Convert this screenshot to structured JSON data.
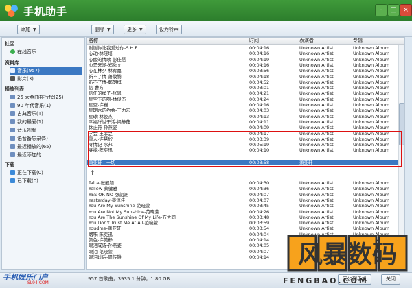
{
  "app": {
    "title": "手机助手"
  },
  "toolbar": {
    "add": "添加",
    "delete": "删除",
    "more": "更多",
    "ringtone": "设为铃声"
  },
  "sidebar": {
    "community": "社区",
    "online_music": "在线音乐",
    "library": "资料库",
    "music": "音乐(957)",
    "video": "影片(3)",
    "playlists_title": "播放列表",
    "playlists": [
      "25 大金曲排行榜(25)",
      "90 年代音乐(1)",
      "古典音乐(1)",
      "我的最爱(1)",
      "音乐视频",
      "语音备忘录(5)",
      "最近播放的(65)",
      "最近添加的"
    ],
    "downloads_title": "下载",
    "downloading": "正在下载(0)",
    "downloaded": "已下载(0)"
  },
  "columns": {
    "name": "名称",
    "time": "时间",
    "artist": "表演者",
    "album": "专辑"
  },
  "rows_top": [
    {
      "name": "谢谢你让我爱过你-S.H.E.",
      "time": "00:04:16",
      "artist": "Unknown Artist",
      "album": "Unknown Album"
    },
    {
      "name": "心动-林晓培",
      "time": "00:04:16",
      "artist": "Unknown Artist",
      "album": "Unknown Album"
    },
    {
      "name": "心酸的情歌-彭佳慧",
      "time": "00:04:19",
      "artist": "Unknown Artist",
      "album": "Unknown Album"
    },
    {
      "name": "心是来潮-郑秀文",
      "time": "00:04:16",
      "artist": "Unknown Artist",
      "album": "Unknown Album"
    },
    {
      "name": "心在林夕-林宥嘉",
      "time": "00:03:56",
      "artist": "Unknown Artist",
      "album": "Unknown Album"
    },
    {
      "name": "新不了情-萧敬腾",
      "time": "00:04:18",
      "artist": "Unknown Artist",
      "album": "Unknown Album"
    },
    {
      "name": "新不了情-鄭朗棋",
      "time": "00:04:52",
      "artist": "Unknown Artist",
      "album": "Unknown Album"
    },
    {
      "name": "信-曹方",
      "time": "00:03:01",
      "artist": "Unknown Artist",
      "album": "Unknown Album"
    },
    {
      "name": "信任的样子-张恩",
      "time": "00:04:21",
      "artist": "Unknown Artist",
      "album": "Unknown Album"
    },
    {
      "name": "星空下的吻-林俊杰",
      "time": "00:04:24",
      "artist": "Unknown Artist",
      "album": "Unknown Album"
    },
    {
      "name": "星空-许巍",
      "time": "00:04:16",
      "artist": "Unknown Artist",
      "album": "Unknown Album"
    },
    {
      "name": "星期六的约会-王力宏",
      "time": "00:04:03",
      "artist": "Unknown Artist",
      "album": "Unknown Album"
    },
    {
      "name": "星球-林俊杰",
      "time": "00:04:13",
      "artist": "Unknown Artist",
      "album": "Unknown Album"
    },
    {
      "name": "幸福洋溢于活-梁静茹",
      "time": "00:04:11",
      "artist": "Unknown Artist",
      "album": "Unknown Album"
    },
    {
      "name": "休止符-孙燕姿",
      "time": "00:04:09",
      "artist": "Unknown Artist",
      "album": "Unknown Album"
    },
    {
      "name": "学会-王菲之",
      "time": "00:04:17",
      "artist": "Unknown Artist",
      "album": "Unknown Album"
    },
    {
      "name": "雪人-许慧欣",
      "time": "00:03:39",
      "artist": "Unknown Artist",
      "album": "Unknown Album"
    },
    {
      "name": "寻情记-水邦",
      "time": "00:05:19",
      "artist": "Unknown Artist",
      "album": "Unknown Album"
    },
    {
      "name": "寻找-陈奕迅",
      "time": "00:04:10",
      "artist": "Unknown Artist",
      "album": "Unknown Album"
    }
  ],
  "selected_row": {
    "name": "萧亚轩 - 一切",
    "time": "00:03:58",
    "artist": "萧亚轩",
    "album": ""
  },
  "rows_bottom": [
    {
      "name": "Talta-张靓颖",
      "time": "00:04:30",
      "artist": "Unknown Artist",
      "album": "Unknown Album"
    },
    {
      "name": "Yellow-蔡健雅",
      "time": "00:04:36",
      "artist": "Unknown Artist",
      "album": "Unknown Album"
    },
    {
      "name": "YES OR NO-张韶涵",
      "time": "00:04:07",
      "artist": "Unknown Artist",
      "album": "Unknown Album"
    },
    {
      "name": "Yesterday-蔡淳佳",
      "time": "00:04:07",
      "artist": "Unknown Artist",
      "album": "Unknown Album"
    },
    {
      "name": "You Are My Sunshine-范晓萱",
      "time": "00:03:45",
      "artist": "Unknown Artist",
      "album": "Unknown Album"
    },
    {
      "name": "You Are Not My Sunshine-范晓萱",
      "time": "00:04:26",
      "artist": "Unknown Artist",
      "album": "Unknown Album"
    },
    {
      "name": "You Are The Sunshine Of My Life-方大同",
      "time": "00:03:48",
      "artist": "Unknown Artist",
      "album": "Unknown Album"
    },
    {
      "name": "You Don't Trust Me At All-范晓萱",
      "time": "00:03:59",
      "artist": "Unknown Artist",
      "album": "Unknown Album"
    },
    {
      "name": "Youdme-萧亚轩",
      "time": "00:03:54",
      "artist": "Unknown Artist",
      "album": "Unknown Album"
    },
    {
      "name": "烟味-陈奕迅",
      "time": "00:04:04",
      "artist": "Unknown Artist",
      "album": "Unknown Album"
    },
    {
      "name": "颜色-许美静",
      "time": "00:04:14",
      "artist": "Unknown Artist",
      "album": "Unknown Album"
    },
    {
      "name": "眼泪成诗-孙燕姿",
      "time": "00:04:05",
      "artist": "Unknown Artist",
      "album": "Unknown Album"
    },
    {
      "name": "眼泪-范晓萱",
      "time": "00:04:07",
      "artist": "Unknown Artist",
      "album": "Unknown Album"
    },
    {
      "name": "眼泪过后-周传雄",
      "time": "00:04:14",
      "artist": "Unknown Artist",
      "album": "Unknown Album"
    }
  ],
  "status": {
    "text": "957 首歌曲，3935.1 分钟，1.80 GB",
    "sync": "同步到手机",
    "close": "关闭"
  },
  "watermarks": {
    "site": "手机娱乐门户",
    "site_sub": "SL94.COM",
    "logo": "风暴数码",
    "logo_sub": "FENGBAO.COM"
  }
}
